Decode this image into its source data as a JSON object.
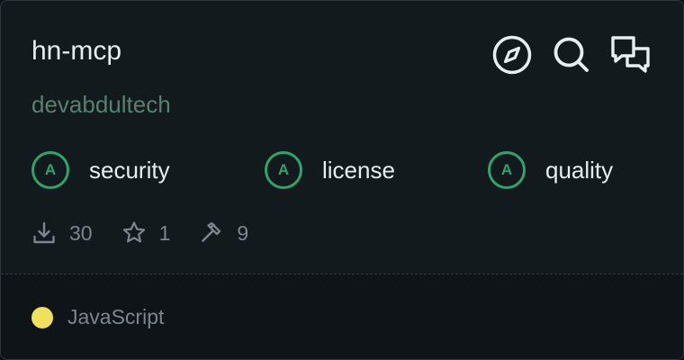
{
  "repo": {
    "name": "hn-mcp",
    "owner": "devabdultech"
  },
  "actions": [
    {
      "icon": "compass-icon",
      "label": "Explore"
    },
    {
      "icon": "search-icon",
      "label": "Search"
    },
    {
      "icon": "chat-icon",
      "label": "Discussions"
    }
  ],
  "grades": [
    {
      "grade": "A",
      "label": "security"
    },
    {
      "grade": "A",
      "label": "license"
    },
    {
      "grade": "A",
      "label": "quality"
    }
  ],
  "stats": {
    "downloads": "30",
    "stars": "1",
    "tools": "9"
  },
  "language": {
    "name": "JavaScript",
    "color": "#f1e05a"
  },
  "colors": {
    "grade_accent": "#2ea46a",
    "owner_text": "#58806d"
  }
}
